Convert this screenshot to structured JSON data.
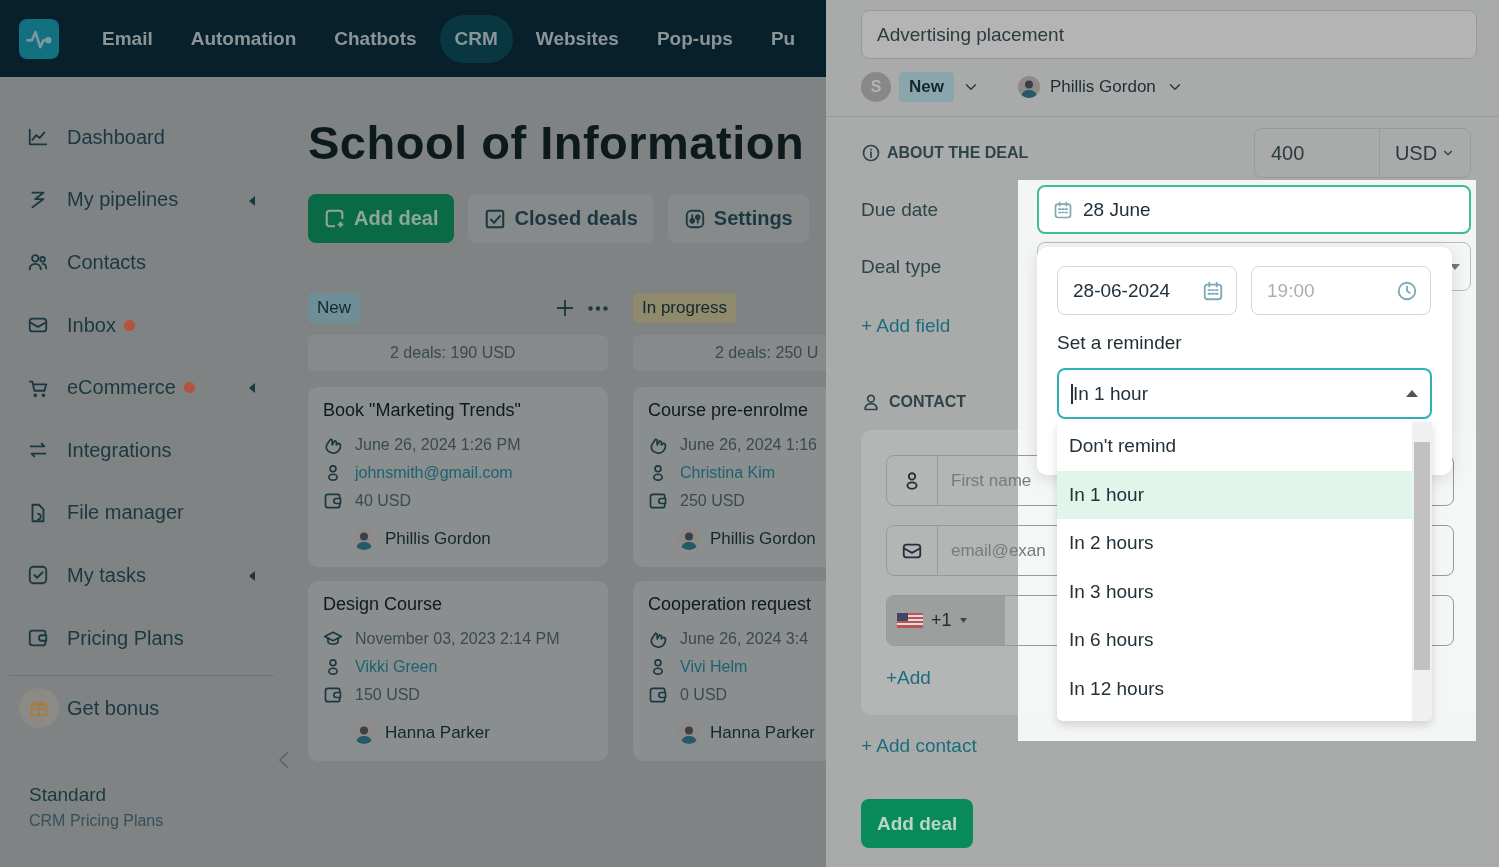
{
  "nav": {
    "items": [
      {
        "label": "Email",
        "selected": false
      },
      {
        "label": "Automation",
        "selected": false
      },
      {
        "label": "Chatbots",
        "selected": false
      },
      {
        "label": "CRM",
        "selected": true
      },
      {
        "label": "Websites",
        "selected": false
      },
      {
        "label": "Pop-ups",
        "selected": false
      },
      {
        "label": "Pu",
        "selected": false
      }
    ]
  },
  "sidebar": {
    "items": [
      {
        "label": "Dashboard",
        "badge": false,
        "expandable": false
      },
      {
        "label": "My pipelines",
        "badge": false,
        "expandable": true
      },
      {
        "label": "Contacts",
        "badge": false,
        "expandable": false
      },
      {
        "label": "Inbox",
        "badge": true,
        "expandable": false
      },
      {
        "label": "eCommerce",
        "badge": true,
        "expandable": true
      },
      {
        "label": "Integrations",
        "badge": false,
        "expandable": false
      },
      {
        "label": "File manager",
        "badge": false,
        "expandable": false
      },
      {
        "label": "My tasks",
        "badge": false,
        "expandable": true
      },
      {
        "label": "Pricing Plans",
        "badge": false,
        "expandable": false
      }
    ],
    "bonus": "Get bonus",
    "plan": {
      "name": "Standard",
      "link": "CRM Pricing Plans"
    }
  },
  "main": {
    "title": "School of Information",
    "buttons": [
      "Add deal",
      "Closed deals",
      "Settings"
    ],
    "columns": [
      {
        "name": "New",
        "color": "#6f8f98",
        "summary": "2 deals: 190 USD",
        "deals": [
          {
            "kind": "order",
            "title": "Book \"Marketing Trends\"",
            "date": "June 26, 2024 1:26 PM",
            "contact": "johnsmith@gmail.com",
            "amount": "40 USD",
            "owner": "Phillis Gordon"
          },
          {
            "kind": "course",
            "title": "Design Course",
            "date": "November 03, 2023 2:14 PM",
            "contact": "Vikki Green",
            "amount": "150 USD",
            "owner": "Hanna Parker"
          }
        ]
      },
      {
        "name": "In progress",
        "color": "#8f8a6c",
        "summary": "2 deals: 250 U",
        "deals": [
          {
            "kind": "order",
            "title": "Course pre-enrolme",
            "date": "June 26, 2024 1:16",
            "contact": "Christina Kim",
            "amount": "250 USD",
            "owner": "Phillis Gordon"
          },
          {
            "kind": "order",
            "title": "Cooperation request",
            "date": "June 26, 2024 3:4",
            "contact": "Vivi Helm",
            "amount": "0 USD",
            "owner": "Hanna Parker"
          }
        ]
      }
    ]
  },
  "deal": {
    "title": "Advertising placement",
    "stage": {
      "initial": "S",
      "label": "New"
    },
    "owner": "Phillis Gordon",
    "about": {
      "heading": "ABOUT THE DEAL",
      "amount": "400",
      "currency": "USD"
    },
    "due_date": {
      "label": "Due date",
      "value": "28 June"
    },
    "deal_type": {
      "label": "Deal type"
    },
    "add_field": "+ Add field",
    "contact": {
      "heading": "CONTACT",
      "first_name_placeholder": "First name",
      "email_placeholder": "email@exan",
      "phone_code": "+1",
      "add": "+Add"
    },
    "add_contact": "+ Add contact",
    "submit": "Add deal"
  },
  "date_popup": {
    "date": "28-06-2024",
    "time_placeholder": "19:00",
    "reminder_label": "Set a reminder",
    "reminder_value": "In 1 hour",
    "options": [
      {
        "label": "Don't remind",
        "selected": false
      },
      {
        "label": "In 1 hour",
        "selected": true
      },
      {
        "label": "In 2 hours",
        "selected": false
      },
      {
        "label": "In 3 hours",
        "selected": false
      },
      {
        "label": "In 6 hours",
        "selected": false
      },
      {
        "label": "In 12 hours",
        "selected": false
      }
    ]
  }
}
